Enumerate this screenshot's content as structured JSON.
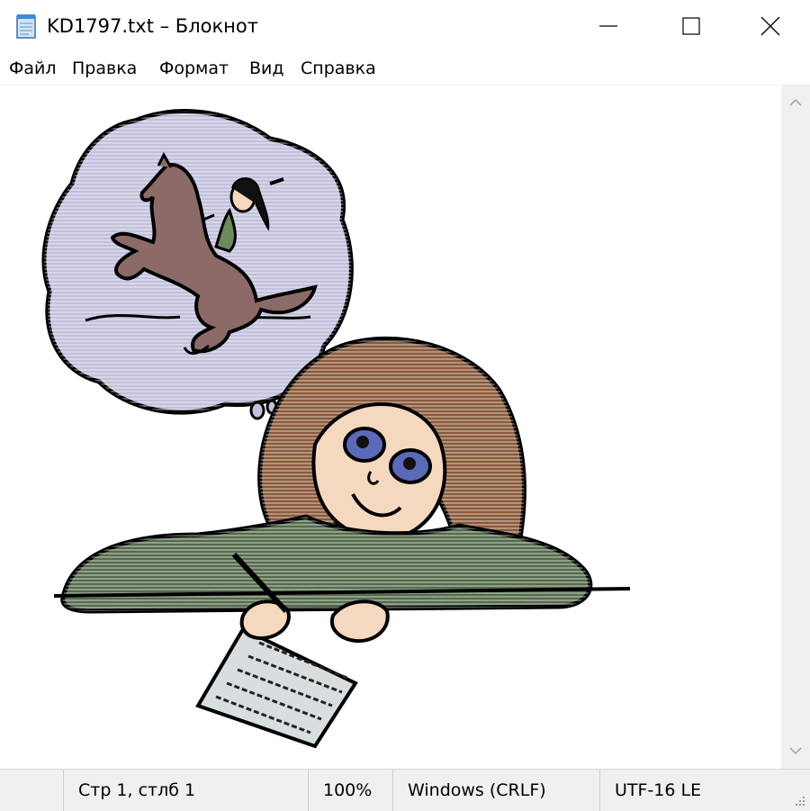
{
  "window": {
    "title": "KD1797.txt – Блокнот",
    "icon": "notepad-icon"
  },
  "menu": {
    "items": [
      "Файл",
      "Правка",
      "Формат",
      "Вид",
      "Справка"
    ]
  },
  "status": {
    "position": "Стр 1, стлб 1",
    "zoom": "100%",
    "line_ending": "Windows (CRLF)",
    "encoding": "UTF-16 LE"
  },
  "colors": {
    "hair": "#8a5a3a",
    "skin": "#f5d9bf",
    "sweater": "#556b4b",
    "cloud": "#c2c0dc",
    "horse": "#8b6a68",
    "paper": "#d8dde0"
  }
}
